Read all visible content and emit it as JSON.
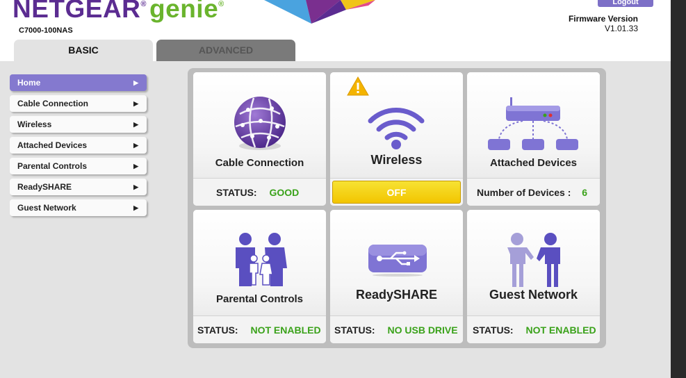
{
  "header": {
    "brand_main": "NETGEAR",
    "brand_reg": "®",
    "brand_genie": "genie",
    "model": "C7000-100NAS",
    "logout_label": "Logout",
    "firmware_label": "Firmware Version",
    "firmware_value": "V1.01.33"
  },
  "tabs": [
    {
      "label": "BASIC"
    },
    {
      "label": "ADVANCED"
    }
  ],
  "sidebar": {
    "items": [
      {
        "label": "Home"
      },
      {
        "label": "Cable Connection"
      },
      {
        "label": "Wireless"
      },
      {
        "label": "Attached Devices"
      },
      {
        "label": "Parental Controls"
      },
      {
        "label": "ReadySHARE"
      },
      {
        "label": "Guest Network"
      }
    ]
  },
  "tiles": {
    "cable": {
      "title": "Cable Connection",
      "status_label": "STATUS:",
      "status_value": "GOOD",
      "icon": "globe-icon"
    },
    "wireless": {
      "title": "Wireless",
      "status_value": "OFF",
      "icon": "wifi-icon",
      "alert_icon": "warning-icon"
    },
    "attached": {
      "title": "Attached Devices",
      "status_label": "Number of Devices :",
      "status_value": "6",
      "icon": "network-devices-icon"
    },
    "parental": {
      "title": "Parental Controls",
      "status_label": "STATUS:",
      "status_value": "NOT ENABLED",
      "icon": "family-icon"
    },
    "readyshare": {
      "title": "ReadySHARE",
      "status_label": "STATUS:",
      "status_value": "NO USB DRIVE",
      "icon": "usb-icon"
    },
    "guest": {
      "title": "Guest Network",
      "status_label": "STATUS:",
      "status_value": "NOT ENABLED",
      "icon": "guests-icon"
    }
  },
  "colors": {
    "brand_purple": "#5b2c91",
    "brand_green": "#6ab42d",
    "nav_active": "#8479cf",
    "status_green": "#3aa21a",
    "off_yellow": "#f2c500"
  }
}
